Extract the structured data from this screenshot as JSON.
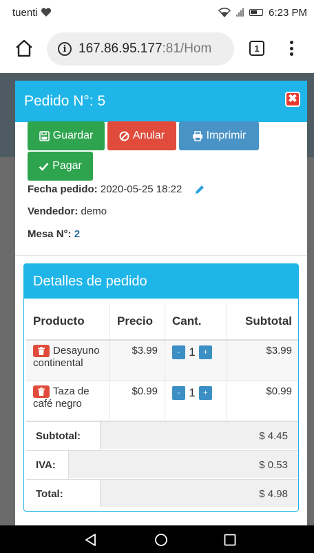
{
  "status_bar": {
    "carrier": "tuenti",
    "time": "6:23 PM"
  },
  "browser": {
    "url_host": "167.86.95.177",
    "url_rest": ":81/Hom",
    "tab_count": "1"
  },
  "modal": {
    "title": "Pedido N°: 5",
    "close": "✖",
    "buttons": {
      "save": "Guardar",
      "cancel": "Anular",
      "print": "Imprimir",
      "pay": "Pagar"
    },
    "order_date_label": "Fecha pedido:",
    "order_date": "2020-05-25 18:22",
    "seller_label": "Vendedor:",
    "seller": "demo",
    "table_label": "Mesa N°:",
    "table_number": "2"
  },
  "details": {
    "title": "Detalles de pedido",
    "columns": [
      "Producto",
      "Precio",
      "Cant.",
      "Subtotal"
    ],
    "rows": [
      {
        "product_line1": "Desayuno",
        "product_line2": "continental",
        "price": "$3.99",
        "qty": "1",
        "subtotal": "$3.99"
      },
      {
        "product_line1": "Taza de",
        "product_line2": "café negro",
        "price": "$0.99",
        "qty": "1",
        "subtotal": "$0.99"
      }
    ],
    "qty_minus": "-",
    "qty_plus": "+",
    "subtotal_label": "Subtotal:",
    "subtotal_value": "$ 4.45",
    "tax_label": "IVA:",
    "tax_value": "$ 0.53",
    "total_label": "Total:",
    "total_value": "$ 4.98"
  },
  "colors": {
    "accent": "#1fb5e8",
    "success": "#2ea44f",
    "danger": "#e04b3b",
    "info": "#4a93c6"
  },
  "icons": [
    "heart-icon",
    "wifi-icon",
    "signal-icon",
    "battery-icon",
    "home-icon",
    "info-icon",
    "tabs-icon",
    "menu-icon",
    "close-icon",
    "save-icon",
    "ban-icon",
    "print-icon",
    "check-icon",
    "pencil-icon",
    "trash-icon",
    "back-icon",
    "circle-home-icon",
    "recents-icon"
  ]
}
